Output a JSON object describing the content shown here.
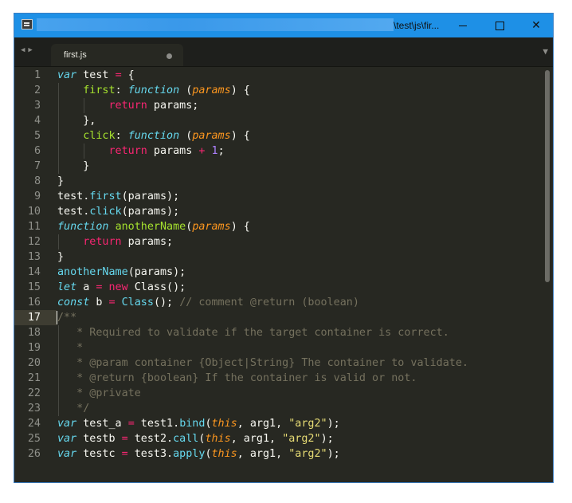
{
  "window": {
    "title_visible": "\\test\\js\\fir...",
    "minimize_glyph": "—",
    "maximize_glyph": "☐",
    "close_glyph": "✕"
  },
  "tabs": {
    "nav_back": "◀",
    "nav_forward": "▶",
    "items": [
      {
        "label": "first.js",
        "modified": true
      }
    ],
    "dropdown_glyph": "▼"
  },
  "editor": {
    "line_numbers": [
      "1",
      "2",
      "3",
      "4",
      "5",
      "6",
      "7",
      "8",
      "9",
      "10",
      "11",
      "12",
      "13",
      "14",
      "15",
      "16",
      "17",
      "18",
      "19",
      "20",
      "21",
      "22",
      "23",
      "24",
      "25",
      "26"
    ],
    "active_line": 17,
    "lines": [
      [
        [
          "kw",
          "var"
        ],
        [
          "pl",
          " test "
        ],
        [
          "op",
          "="
        ],
        [
          "pl",
          " {"
        ]
      ],
      [
        [
          "pl",
          "    "
        ],
        [
          "fd",
          "first"
        ],
        [
          "pl",
          ": "
        ],
        [
          "kw",
          "function"
        ],
        [
          "pl",
          " ("
        ],
        [
          "pa",
          "params"
        ],
        [
          "pl",
          ") {"
        ]
      ],
      [
        [
          "pl",
          "        "
        ],
        [
          "op",
          "return"
        ],
        [
          "pl",
          " params;"
        ]
      ],
      [
        [
          "pl",
          "    },"
        ]
      ],
      [
        [
          "pl",
          "    "
        ],
        [
          "fd",
          "click"
        ],
        [
          "pl",
          ": "
        ],
        [
          "kw",
          "function"
        ],
        [
          "pl",
          " ("
        ],
        [
          "pa",
          "params"
        ],
        [
          "pl",
          ") {"
        ]
      ],
      [
        [
          "pl",
          "        "
        ],
        [
          "op",
          "return"
        ],
        [
          "pl",
          " params "
        ],
        [
          "op",
          "+"
        ],
        [
          "pl",
          " "
        ],
        [
          "nm",
          "1"
        ],
        [
          "pl",
          ";"
        ]
      ],
      [
        [
          "pl",
          "    }"
        ]
      ],
      [
        [
          "pl",
          "}"
        ]
      ],
      [
        [
          "pl",
          "test."
        ],
        [
          "fn",
          "first"
        ],
        [
          "pl",
          "(params);"
        ]
      ],
      [
        [
          "pl",
          "test."
        ],
        [
          "fn",
          "click"
        ],
        [
          "pl",
          "(params);"
        ]
      ],
      [
        [
          "kw",
          "function"
        ],
        [
          "pl",
          " "
        ],
        [
          "fd",
          "anotherName"
        ],
        [
          "pl",
          "("
        ],
        [
          "pa",
          "params"
        ],
        [
          "pl",
          ") {"
        ]
      ],
      [
        [
          "pl",
          "    "
        ],
        [
          "op",
          "return"
        ],
        [
          "pl",
          " params;"
        ]
      ],
      [
        [
          "pl",
          "}"
        ]
      ],
      [
        [
          "fn",
          "anotherName"
        ],
        [
          "pl",
          "(params);"
        ]
      ],
      [
        [
          "kw",
          "let"
        ],
        [
          "pl",
          " a "
        ],
        [
          "op",
          "="
        ],
        [
          "pl",
          " "
        ],
        [
          "op",
          "new"
        ],
        [
          "pl",
          " Class();"
        ]
      ],
      [
        [
          "kw",
          "const"
        ],
        [
          "pl",
          " b "
        ],
        [
          "op",
          "="
        ],
        [
          "pl",
          " "
        ],
        [
          "fn",
          "Class"
        ],
        [
          "pl",
          "(); "
        ],
        [
          "cm",
          "// comment @return (boolean)"
        ]
      ],
      [
        [
          "cm",
          "/**"
        ]
      ],
      [
        [
          "cm",
          "   * Required to validate if the target container is correct."
        ]
      ],
      [
        [
          "cm",
          "   *"
        ]
      ],
      [
        [
          "cm",
          "   * @param container {Object|String} The container to validate."
        ]
      ],
      [
        [
          "cm",
          "   * @return {boolean} If the container is valid or not."
        ]
      ],
      [
        [
          "cm",
          "   * @private"
        ]
      ],
      [
        [
          "cm",
          "   */"
        ]
      ],
      [
        [
          "kw",
          "var"
        ],
        [
          "pl",
          " test_a "
        ],
        [
          "op",
          "="
        ],
        [
          "pl",
          " test1."
        ],
        [
          "fn",
          "bind"
        ],
        [
          "pl",
          "("
        ],
        [
          "pa",
          "this"
        ],
        [
          "pl",
          ", arg1, "
        ],
        [
          "st",
          "\"arg2\""
        ],
        [
          "pl",
          ");"
        ]
      ],
      [
        [
          "kw",
          "var"
        ],
        [
          "pl",
          " testb "
        ],
        [
          "op",
          "="
        ],
        [
          "pl",
          " test2."
        ],
        [
          "fn",
          "call"
        ],
        [
          "pl",
          "("
        ],
        [
          "pa",
          "this"
        ],
        [
          "pl",
          ", arg1, "
        ],
        [
          "st",
          "\"arg2\""
        ],
        [
          "pl",
          ");"
        ]
      ],
      [
        [
          "kw",
          "var"
        ],
        [
          "pl",
          " testc "
        ],
        [
          "op",
          "="
        ],
        [
          "pl",
          " test3."
        ],
        [
          "fn",
          "apply"
        ],
        [
          "pl",
          "("
        ],
        [
          "pa",
          "this"
        ],
        [
          "pl",
          ", arg1, "
        ],
        [
          "st",
          "\"arg2\""
        ],
        [
          "pl",
          ");"
        ]
      ]
    ]
  },
  "colors": {
    "editor_bg": "#272822",
    "titlebar": "#1e90e6",
    "keyword": "#66d9ef",
    "function_def": "#a6e22e",
    "operator": "#f92672",
    "parameter": "#fd971f",
    "number": "#ae81ff",
    "string": "#e6db74",
    "comment": "#75715e"
  }
}
